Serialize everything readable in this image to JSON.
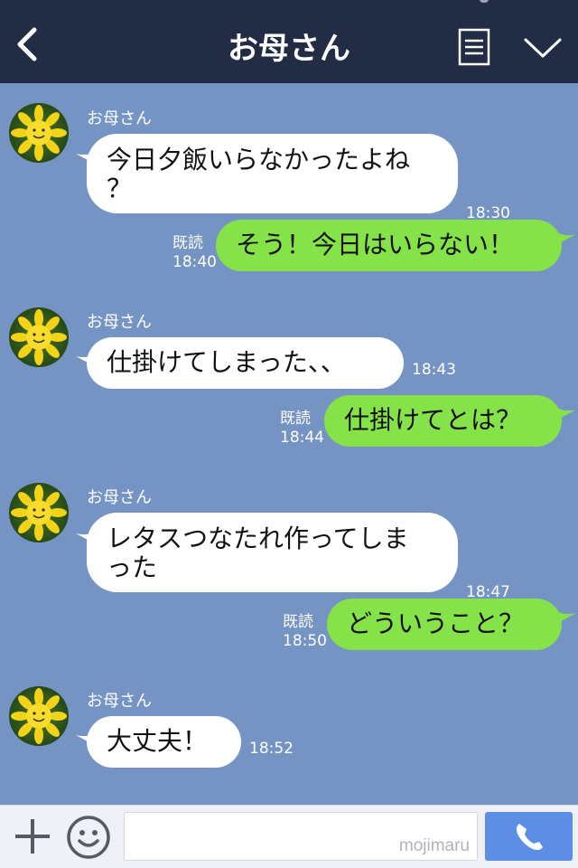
{
  "header": {
    "title": "お母さん",
    "back_icon": "chevron-left-icon",
    "memo_icon": "note-icon",
    "menu_icon": "chevron-down-icon"
  },
  "messages": [
    {
      "sender": "お母さん",
      "text_lines": [
        "今日夕飯いらなかったよね",
        "？"
      ],
      "time": "18:30"
    },
    {
      "text": "そう！今日はいらない！",
      "read": "既読",
      "time": "18:40"
    },
    {
      "sender": "お母さん",
      "text_lines": [
        "仕掛けてしまった、、"
      ],
      "time": "18:43"
    },
    {
      "text": "仕掛けてとは？",
      "read": "既読",
      "time": "18:44"
    },
    {
      "sender": "お母さん",
      "text_lines": [
        "レタスつなたれ作ってしま",
        "った"
      ],
      "time": "18:47"
    },
    {
      "text": "どういうこと？",
      "read": "既読",
      "time": "18:50"
    },
    {
      "sender": "お母さん",
      "text_lines": [
        "大丈夫！"
      ],
      "time": "18:52"
    }
  ],
  "footer": {
    "input_value": "",
    "watermark": "mojimaru",
    "plus_icon": "plus-icon",
    "emoji_icon": "smiley-icon",
    "call_icon": "phone-icon"
  },
  "colors": {
    "header_bg": "#232c45",
    "chat_bg": "#7594c3",
    "incoming_bubble": "#ffffff",
    "outgoing_bubble": "#85e249",
    "call_button": "#5c8ee6"
  }
}
